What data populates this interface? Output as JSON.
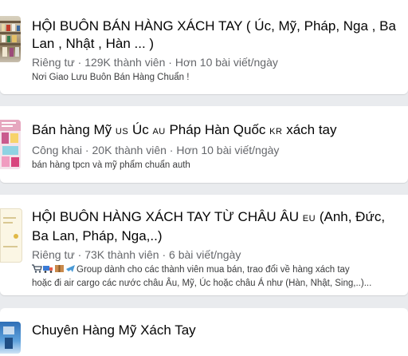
{
  "groups": [
    {
      "title": "HỘI BUÔN BÁN HÀNG XÁCH TAY ( Úc, Mỹ, Pháp, Nga , Ba Lan , Nhật , Hàn ... )",
      "privacy": "Riêng tư",
      "members": "129K thành viên",
      "activity": "Hơn 10 bài viết/ngày",
      "description": "Nơi Giao Lưu Buôn Bán Hàng Chuẩn !"
    },
    {
      "title_part1": "Bán hàng Mỹ",
      "flag1": "US",
      "title_part2": "Úc",
      "flag2": "AU",
      "title_part3": "Pháp Hàn Quốc",
      "flag3": "KR",
      "title_part4": "xách tay",
      "privacy": "Công khai",
      "members": "20K thành viên",
      "activity": "Hơn 10 bài viết/ngày",
      "description": "bán hàng tpcn và mỹ phẩm chuẩn auth"
    },
    {
      "title_part1": "HỘI BUÔN HÀNG XÁCH TAY TỪ CHÂU ÂU",
      "flag1": "EU",
      "title_part2": "(Anh, Đức, Ba Lan, Pháp, Nga,..)",
      "privacy": "Riêng tư",
      "members": "73K thành viên",
      "activity": "6 bài viết/ngày",
      "description_line1": "Group dành cho các thành viên mua bán, trao đổi về hàng xách tay",
      "description_line2": "hoặc đi air cargo các nước châu Âu, Mỹ, Úc hoặc châu Á như (Hàn, Nhật, Sing,..)..."
    },
    {
      "title": "Chuyên Hàng Mỹ Xách Tay"
    }
  ],
  "separator": " · ",
  "icons": [
    "shopping-cart-icon",
    "truck-icon",
    "package-icon",
    "airplane-icon"
  ]
}
